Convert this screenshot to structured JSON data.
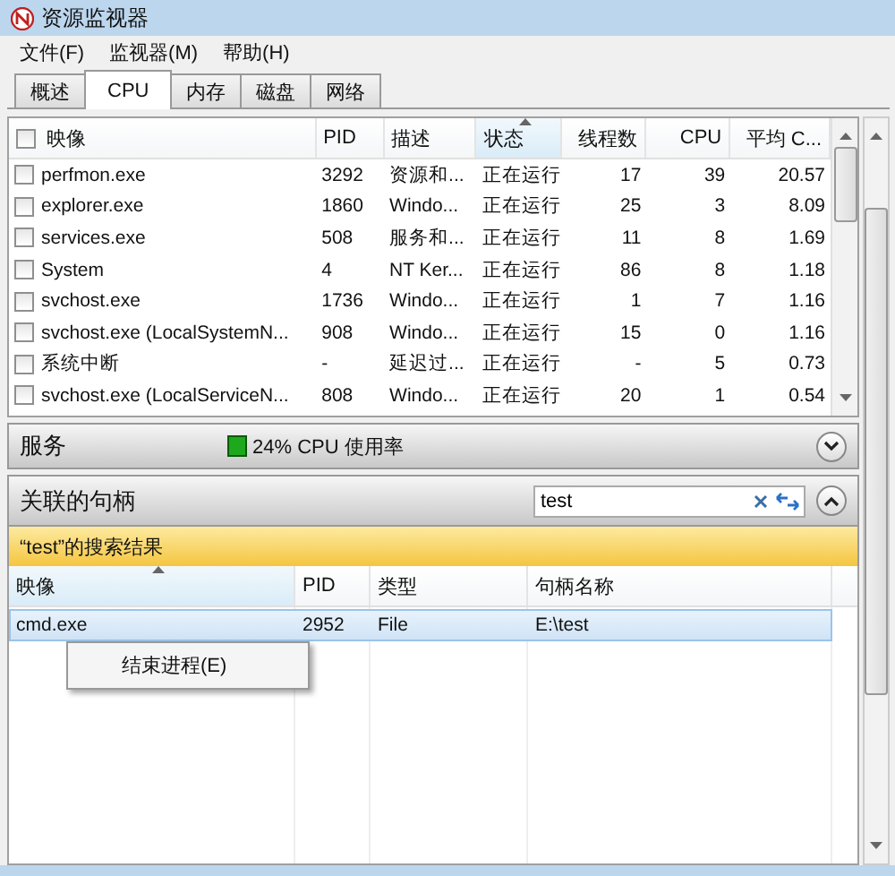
{
  "window": {
    "title": "资源监视器"
  },
  "menu": [
    "文件(F)",
    "监视器(M)",
    "帮助(H)"
  ],
  "tabs": [
    {
      "label": "概述",
      "selected": false
    },
    {
      "label": "CPU",
      "selected": true
    },
    {
      "label": "内存",
      "selected": false
    },
    {
      "label": "磁盘",
      "selected": false
    },
    {
      "label": "网络",
      "selected": false
    }
  ],
  "processes": {
    "columns": [
      {
        "label": "映像",
        "sorted": false
      },
      {
        "label": "PID",
        "sorted": false
      },
      {
        "label": "描述",
        "sorted": false
      },
      {
        "label": "状态",
        "sorted": true
      },
      {
        "label": "线程数",
        "sorted": false
      },
      {
        "label": "CPU",
        "sorted": false
      },
      {
        "label": "平均 C...",
        "sorted": false
      }
    ],
    "header_checked": false,
    "rows": [
      {
        "checked": false,
        "cells": [
          "perfmon.exe",
          "3292",
          "资源和...",
          "正在运行",
          "17",
          "39",
          "20.57"
        ]
      },
      {
        "checked": false,
        "cells": [
          "explorer.exe",
          "1860",
          "Windo...",
          "正在运行",
          "25",
          "3",
          "8.09"
        ]
      },
      {
        "checked": false,
        "cells": [
          "services.exe",
          "508",
          "服务和...",
          "正在运行",
          "11",
          "8",
          "1.69"
        ]
      },
      {
        "checked": false,
        "cells": [
          "System",
          "4",
          "NT Ker...",
          "正在运行",
          "86",
          "8",
          "1.18"
        ]
      },
      {
        "checked": false,
        "cells": [
          "svchost.exe",
          "1736",
          "Windo...",
          "正在运行",
          "1",
          "7",
          "1.16"
        ]
      },
      {
        "checked": false,
        "cells": [
          "svchost.exe (LocalSystemN...",
          "908",
          "Windo...",
          "正在运行",
          "15",
          "0",
          "1.16"
        ]
      },
      {
        "checked": false,
        "cells": [
          "系统中断",
          "-",
          "延迟过...",
          "正在运行",
          "-",
          "5",
          "0.73"
        ]
      },
      {
        "checked": false,
        "cells": [
          "svchost.exe (LocalServiceN...",
          "808",
          "Windo...",
          "正在运行",
          "20",
          "1",
          "0.54"
        ]
      }
    ]
  },
  "services": {
    "title": "服务",
    "usage": "24% CPU 使用率",
    "expanded": false
  },
  "handles": {
    "title": "关联的句柄",
    "search": {
      "value": "test"
    },
    "expanded": true,
    "banner": "“test”的搜索结果",
    "columns": [
      {
        "label": "映像",
        "sorted": true
      },
      {
        "label": "PID",
        "sorted": false
      },
      {
        "label": "类型",
        "sorted": false
      },
      {
        "label": "句柄名称",
        "sorted": false
      }
    ],
    "rows": [
      {
        "selected": true,
        "cells": [
          "cmd.exe",
          "2952",
          "File",
          "E:\\test"
        ]
      }
    ],
    "context_menu": [
      "结束进程(E)"
    ]
  }
}
